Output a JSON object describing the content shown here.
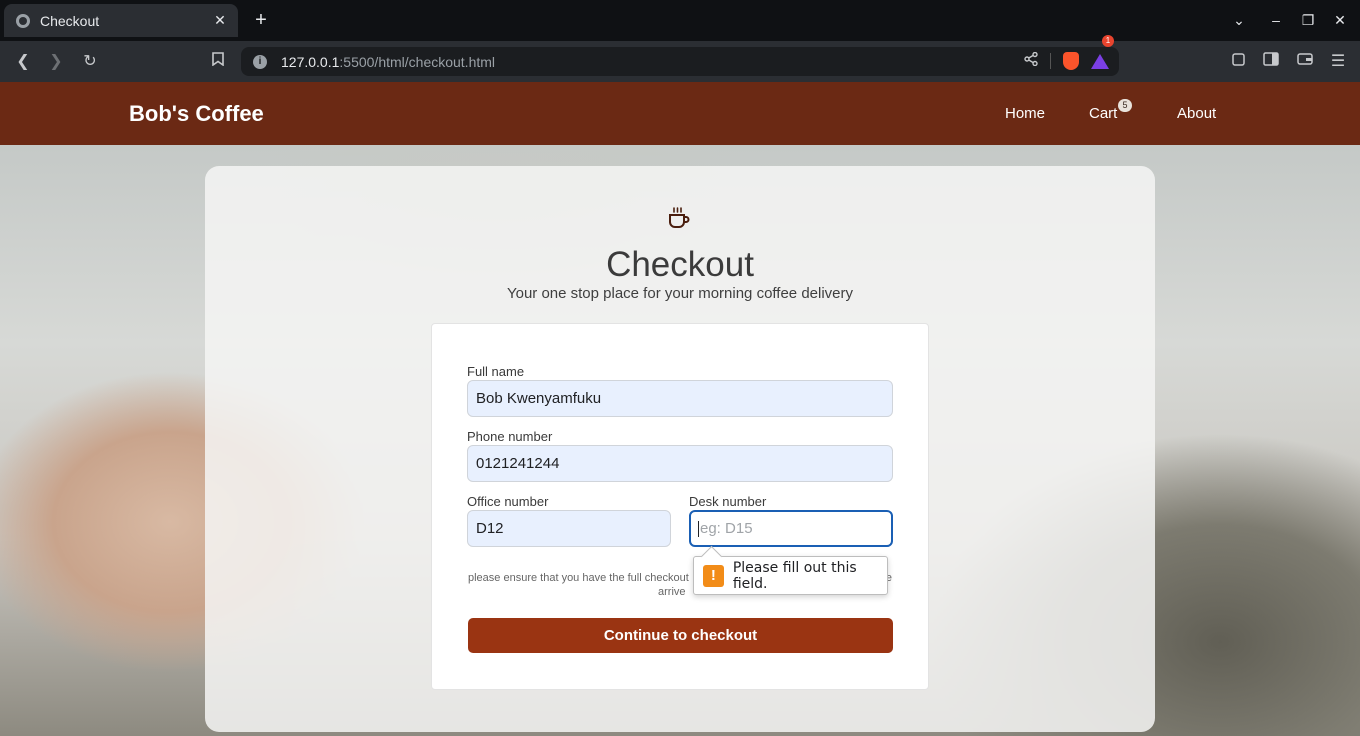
{
  "browser": {
    "tab_title": "Checkout",
    "tab_close": "✕",
    "new_tab": "+",
    "url_host": "127.0.0.1",
    "url_rest": ":5500/html/checkout.html",
    "rewards_count": "1",
    "icons": [
      "globe-icon",
      "back-icon",
      "forward-icon",
      "reload-icon",
      "bookmark-icon",
      "info-icon",
      "share-icon",
      "brave-shield-icon",
      "brave-rewards-icon",
      "extensions-icon",
      "sidebar-icon",
      "wallet-icon",
      "menu-icon",
      "minimize-icon",
      "maximize-icon",
      "close-icon",
      "chevron-down-icon"
    ]
  },
  "site": {
    "brand": "Bob's Coffee",
    "nav": {
      "home": "Home",
      "cart": "Cart",
      "cart_count": "5",
      "about": "About"
    },
    "colors": {
      "navbar": "#6b2914",
      "button": "#9a3412",
      "focus": "#1a5fb4"
    }
  },
  "checkout": {
    "title": "Checkout",
    "subtitle": "Your one stop place for your morning coffee delivery",
    "fields": {
      "full_name": {
        "label": "Full name",
        "value": "Bob Kwenyamfuku"
      },
      "phone": {
        "label": "Phone number",
        "value": "0121241244"
      },
      "office": {
        "label": "Office number",
        "value": "D12"
      },
      "desk": {
        "label": "Desk number",
        "placeholder": "eg: D15",
        "value": ""
      }
    },
    "note_left": "please ensure that you have the full checkout",
    "note_right": "e",
    "note_line2": "arrive",
    "submit": "Continue to checkout"
  },
  "validation": {
    "message": "Please fill out this field.",
    "icon": "!"
  }
}
